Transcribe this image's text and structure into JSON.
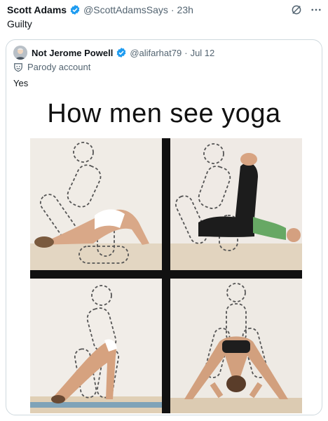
{
  "tweet": {
    "author_name": "Scott Adams",
    "author_handle": "@ScottAdamsSays",
    "time": "23h",
    "text": "Guilty"
  },
  "quoted_tweet": {
    "author_name": "Not Jerome Powell",
    "author_handle": "@alifarhat79",
    "date": "Jul 12",
    "label": "Parody account",
    "text": "Yes"
  },
  "meme": {
    "title": "How men see yoga"
  },
  "colors": {
    "verified": "#1d9bf0",
    "secondary_text": "#536471",
    "border": "#cfd9de"
  },
  "icons": [
    "verified-badge-icon",
    "grok-icon",
    "more-icon",
    "parody-icon"
  ]
}
